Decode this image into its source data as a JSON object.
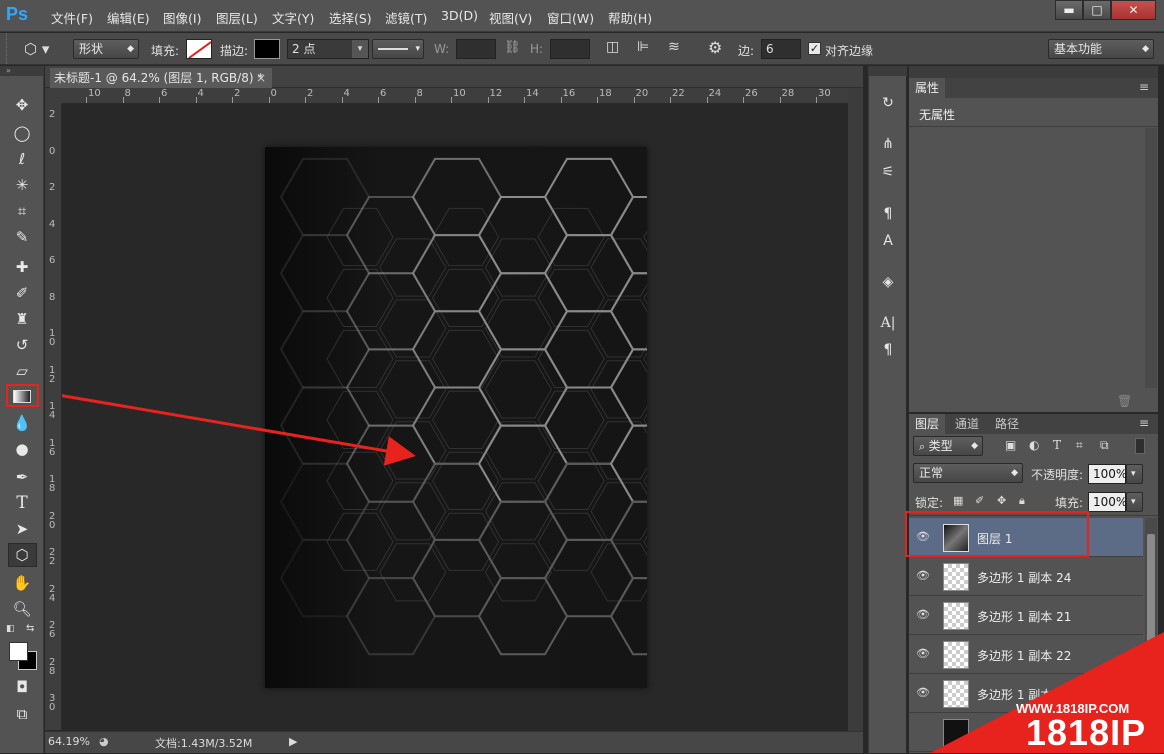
{
  "app": {
    "logo": "Ps"
  },
  "menu": [
    "文件(F)",
    "编辑(E)",
    "图像(I)",
    "图层(L)",
    "文字(Y)",
    "选择(S)",
    "滤镜(T)",
    "3D(D)",
    "视图(V)",
    "窗口(W)",
    "帮助(H)"
  ],
  "window_controls": {
    "minimize": "▬",
    "maximize": "□",
    "close": "✕"
  },
  "options": {
    "shape_mode": "形状",
    "fill_label": "填充:",
    "stroke_label": "描边:",
    "stroke_width": "2 点",
    "w_label": "W:",
    "h_label": "H:",
    "sides_label": "边:",
    "sides_value": "6",
    "align_edges_label": "对齐边缘",
    "workspace": "基本功能"
  },
  "document": {
    "tab_title": "未标题-1 @ 64.2% (图层 1, RGB/8) *",
    "close": "×",
    "ruler_h": [
      "10",
      "8",
      "6",
      "4",
      "2",
      "0",
      "2",
      "4",
      "6",
      "8",
      "10",
      "12",
      "14",
      "16",
      "18",
      "20",
      "22",
      "24",
      "26",
      "28",
      "30"
    ],
    "ruler_v": [
      "2",
      "0",
      "2",
      "4",
      "6",
      "8",
      "1 0",
      "1 2",
      "1 4",
      "1 6",
      "1 8",
      "2 0",
      "2 2",
      "2 4",
      "2 6",
      "2 8",
      "3 0"
    ]
  },
  "status": {
    "zoom": "64.19%",
    "doc_info": "文档:1.43M/3.52M"
  },
  "properties_panel": {
    "title": "属性",
    "content": "无属性"
  },
  "layers_panel": {
    "tabs": [
      "图层",
      "通道",
      "路径"
    ],
    "filter_kind": "类型",
    "blend_mode": "正常",
    "opacity_label": "不透明度:",
    "opacity_value": "100%",
    "lock_label": "锁定:",
    "fill_label": "填充:",
    "fill_value": "100%",
    "layers": [
      {
        "name": "图层 1",
        "selected": true
      },
      {
        "name": "多边形 1 副本 24",
        "selected": false
      },
      {
        "name": "多边形 1 副本 21",
        "selected": false
      },
      {
        "name": "多边形 1 副本 22",
        "selected": false
      },
      {
        "name": "多边形 1 副本",
        "selected": false
      }
    ]
  },
  "watermark": {
    "url": "WWW.1818IP.COM",
    "brand": "1818IP"
  },
  "colors": {
    "highlight_red": "#e8221c",
    "layer_selected": "#5c6b86",
    "ui_bg": "#535353"
  }
}
